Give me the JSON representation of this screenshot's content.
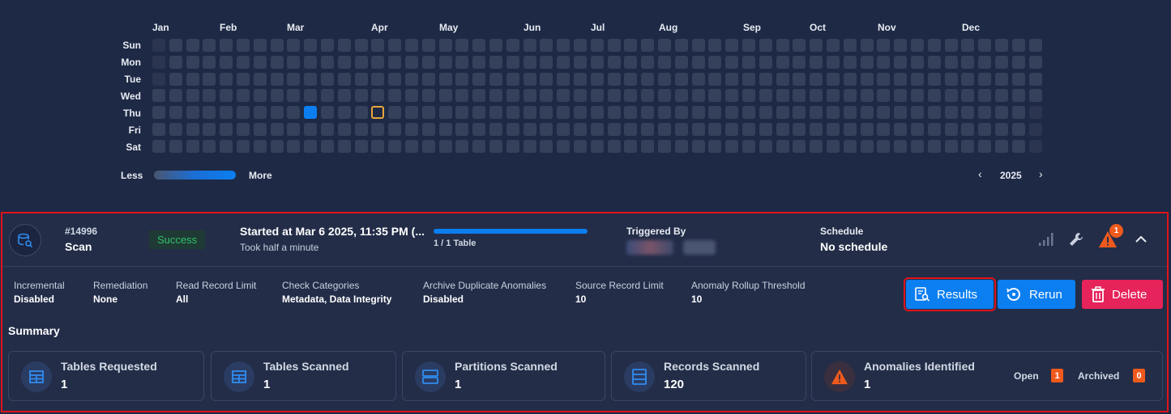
{
  "heatmap": {
    "months": [
      "Jan",
      "Feb",
      "Mar",
      "Apr",
      "May",
      "Jun",
      "Jul",
      "Aug",
      "Sep",
      "Oct",
      "Nov",
      "Dec"
    ],
    "days": [
      "Sun",
      "Mon",
      "Tue",
      "Wed",
      "Thu",
      "Fri",
      "Sat"
    ],
    "legend_less": "Less",
    "legend_more": "More",
    "year": "2025",
    "prev_year_icon": "chevron-left-icon",
    "next_year_icon": "chevron-right-icon",
    "active_cells": [
      {
        "month": "Mar",
        "day": 6,
        "count_level": "high"
      }
    ],
    "highlighted_cells": [
      {
        "month": "Apr",
        "day": 3
      }
    ],
    "colors": {
      "empty": "#35405a",
      "active": "#0b7ef0",
      "highlight": "#e8a53c"
    }
  },
  "operation": {
    "id": "#14996",
    "type": "Scan",
    "status": "Success",
    "started": "Started at Mar 6 2025, 11:35 PM (...",
    "duration": "Took half a minute",
    "progress_label": "1 / 1 Table",
    "progress_fraction": 1.0,
    "triggered_by_label": "Triggered By",
    "schedule_label": "Schedule",
    "schedule_value": "No schedule",
    "anomaly_notification_count": "1",
    "header_icons": [
      "signal-icon",
      "wrench-icon",
      "warning-icon",
      "chevron-up-icon"
    ]
  },
  "settings": [
    {
      "label": "Incremental",
      "value": "Disabled"
    },
    {
      "label": "Remediation",
      "value": "None"
    },
    {
      "label": "Read Record Limit",
      "value": "All"
    },
    {
      "label": "Check Categories",
      "value": "Metadata, Data Integrity"
    },
    {
      "label": "Archive Duplicate Anomalies",
      "value": "Disabled"
    },
    {
      "label": "Source Record Limit",
      "value": "10"
    },
    {
      "label": "Anomaly Rollup Threshold",
      "value": "10"
    }
  ],
  "actions": {
    "results": "Results",
    "rerun": "Rerun",
    "delete": "Delete"
  },
  "summary": {
    "title": "Summary",
    "stats": [
      {
        "label": "Tables Requested",
        "value": "1",
        "icon": "table-icon"
      },
      {
        "label": "Tables Scanned",
        "value": "1",
        "icon": "table-icon"
      },
      {
        "label": "Partitions Scanned",
        "value": "1",
        "icon": "partition-icon"
      },
      {
        "label": "Records Scanned",
        "value": "120",
        "icon": "records-icon"
      },
      {
        "label": "Anomalies Identified",
        "value": "1",
        "icon": "warning-icon"
      }
    ],
    "open_label": "Open",
    "open_count": "1",
    "archived_label": "Archived",
    "archived_count": "0"
  }
}
